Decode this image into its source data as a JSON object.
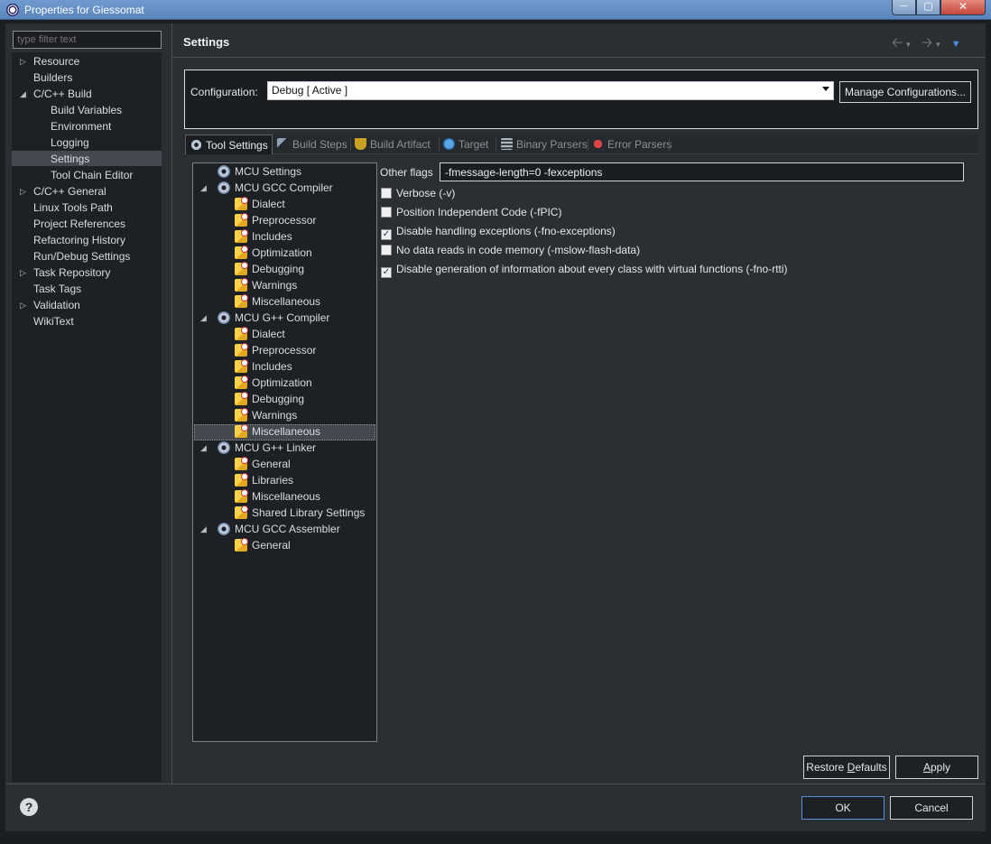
{
  "window": {
    "title": "Properties for Giessomat"
  },
  "filter": {
    "placeholder": "type filter text"
  },
  "nav": {
    "items": [
      {
        "label": "Resource",
        "expander": "collapsed"
      },
      {
        "label": "Builders",
        "expander": "none"
      },
      {
        "label": "C/C++ Build",
        "expander": "expanded"
      },
      {
        "label": "Build Variables",
        "expander": "none"
      },
      {
        "label": "Environment",
        "expander": "none"
      },
      {
        "label": "Logging",
        "expander": "none"
      },
      {
        "label": "Settings",
        "expander": "none",
        "selected": true
      },
      {
        "label": "Tool Chain Editor",
        "expander": "none"
      },
      {
        "label": "C/C++ General",
        "expander": "collapsed"
      },
      {
        "label": "Linux Tools Path",
        "expander": "none"
      },
      {
        "label": "Project References",
        "expander": "none"
      },
      {
        "label": "Refactoring History",
        "expander": "none"
      },
      {
        "label": "Run/Debug Settings",
        "expander": "none"
      },
      {
        "label": "Task Repository",
        "expander": "collapsed"
      },
      {
        "label": "Task Tags",
        "expander": "none"
      },
      {
        "label": "Validation",
        "expander": "collapsed"
      },
      {
        "label": "WikiText",
        "expander": "none"
      }
    ]
  },
  "header": {
    "title": "Settings"
  },
  "config": {
    "label": "Configuration:",
    "value": "Debug  [ Active ]",
    "manage_label": "Manage Configurations..."
  },
  "tabs": [
    {
      "label": "Tool Settings",
      "icon": "tool-settings-icon",
      "active": true
    },
    {
      "label": "Build Steps",
      "icon": "build-steps-icon"
    },
    {
      "label": "Build Artifact",
      "icon": "trophy-icon"
    },
    {
      "label": "Target",
      "icon": "globe-icon"
    },
    {
      "label": "Binary Parsers",
      "icon": "binary-parsers-icon"
    },
    {
      "label": "Error Parsers",
      "icon": "error-parsers-icon"
    }
  ],
  "tree": {
    "items": [
      {
        "label": "MCU Settings",
        "icon": "gear",
        "expander": "none"
      },
      {
        "label": "MCU GCC Compiler",
        "icon": "gear",
        "expander": "expanded"
      },
      {
        "label": "Dialect",
        "icon": "folder"
      },
      {
        "label": "Preprocessor",
        "icon": "folder"
      },
      {
        "label": "Includes",
        "icon": "folder"
      },
      {
        "label": "Optimization",
        "icon": "folder"
      },
      {
        "label": "Debugging",
        "icon": "folder"
      },
      {
        "label": "Warnings",
        "icon": "folder"
      },
      {
        "label": "Miscellaneous",
        "icon": "folder"
      },
      {
        "label": "MCU G++ Compiler",
        "icon": "gear",
        "expander": "expanded"
      },
      {
        "label": "Dialect",
        "icon": "folder"
      },
      {
        "label": "Preprocessor",
        "icon": "folder"
      },
      {
        "label": "Includes",
        "icon": "folder"
      },
      {
        "label": "Optimization",
        "icon": "folder"
      },
      {
        "label": "Debugging",
        "icon": "folder"
      },
      {
        "label": "Warnings",
        "icon": "folder"
      },
      {
        "label": "Miscellaneous",
        "icon": "folder",
        "selected": true
      },
      {
        "label": "MCU G++ Linker",
        "icon": "gear",
        "expander": "expanded"
      },
      {
        "label": "General",
        "icon": "folder"
      },
      {
        "label": "Libraries",
        "icon": "folder"
      },
      {
        "label": "Miscellaneous",
        "icon": "folder"
      },
      {
        "label": "Shared Library Settings",
        "icon": "folder"
      },
      {
        "label": "MCU GCC Assembler",
        "icon": "gear",
        "expander": "expanded"
      },
      {
        "label": "General",
        "icon": "folder"
      }
    ]
  },
  "options": {
    "flags_label": "Other flags",
    "flags_value": "-fmessage-length=0 -fexceptions",
    "checkboxes": [
      {
        "label": "Verbose (-v)",
        "checked": false
      },
      {
        "label": "Position Independent Code (-fPIC)",
        "checked": false
      },
      {
        "label": "Disable handling exceptions (-fno-exceptions)",
        "checked": true
      },
      {
        "label": "No data reads in code memory (-mslow-flash-data)",
        "checked": false
      },
      {
        "label": "Disable generation of information about every class with virtual functions (-fno-rtti)",
        "checked": true
      }
    ]
  },
  "buttons": {
    "restore_pre": "Restore ",
    "restore_u": "D",
    "restore_post": "efaults",
    "apply_u": "A",
    "apply_post": "pply",
    "ok": "OK",
    "cancel": "Cancel",
    "help": "?"
  }
}
